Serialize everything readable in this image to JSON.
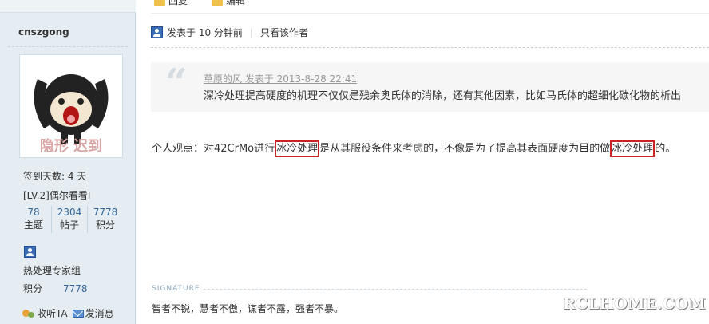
{
  "sidebar": {
    "username": "cnszgong",
    "avatar": {
      "caption": "隐形 迟到"
    },
    "signin_days": "签到天数: 4 天",
    "level": "[LV.2]偶尔看看I",
    "stats": [
      {
        "value": "78",
        "label": "主题"
      },
      {
        "value": "2304",
        "label": "帖子"
      },
      {
        "value": "7778",
        "label": "积分"
      }
    ],
    "group": "热处理专家组",
    "points_label": "积分",
    "points_value": "7778",
    "follow_label": "收听TA",
    "message_label": "发消息"
  },
  "post": {
    "top_actions": [
      "回复",
      "编辑"
    ],
    "meta_time": "发表于 10 分钟前",
    "meta_only_author": "只看该作者",
    "quote": {
      "header": "草原的风 发表于 2013-8-28 22:41",
      "text": "深冷处理提高硬度的机理不仅仅是残余奥氏体的消除，还有其他因素，比如马氏体的超细化碳化物的析出"
    },
    "body": {
      "part1": "个人观点：对42CrMo进行",
      "highlight1": "冰冷处理",
      "part2": "是从其服役条件来考虑的，不像是为了提高其表面硬度为目的做",
      "highlight2": "冰冷处理",
      "part3": "的。"
    },
    "signature_label": "SIGNATURE",
    "signature_text": "智者不锐，慧者不傲，谋者不露，强者不暴。"
  },
  "watermark": "RCLHOME.COM"
}
